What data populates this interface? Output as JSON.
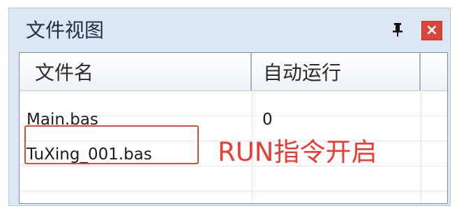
{
  "panel": {
    "title": "文件视图"
  },
  "columns": [
    "文件名",
    "自动运行"
  ],
  "rows": [
    {
      "file": "Main.bas",
      "auto_run": "0"
    },
    {
      "file": "TuXing_001.bas",
      "auto_run": ""
    }
  ],
  "annotation": "RUN指令开启",
  "icons": {
    "pin": "pin-icon",
    "close": "close-icon"
  },
  "colors": {
    "close_bg": "#d9453b",
    "annotation": "#ef3a34",
    "panel_bg": "#dde7f3"
  }
}
